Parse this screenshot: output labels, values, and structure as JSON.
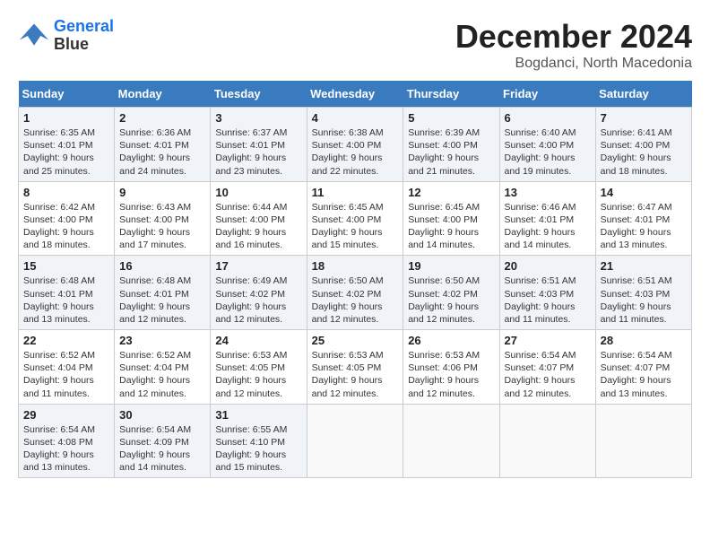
{
  "header": {
    "logo_line1": "General",
    "logo_line2": "Blue",
    "month_title": "December 2024",
    "location": "Bogdanci, North Macedonia"
  },
  "weekdays": [
    "Sunday",
    "Monday",
    "Tuesday",
    "Wednesday",
    "Thursday",
    "Friday",
    "Saturday"
  ],
  "weeks": [
    [
      {
        "day": "1",
        "sunrise": "6:35 AM",
        "sunset": "4:01 PM",
        "daylight": "9 hours and 25 minutes."
      },
      {
        "day": "2",
        "sunrise": "6:36 AM",
        "sunset": "4:01 PM",
        "daylight": "9 hours and 24 minutes."
      },
      {
        "day": "3",
        "sunrise": "6:37 AM",
        "sunset": "4:01 PM",
        "daylight": "9 hours and 23 minutes."
      },
      {
        "day": "4",
        "sunrise": "6:38 AM",
        "sunset": "4:00 PM",
        "daylight": "9 hours and 22 minutes."
      },
      {
        "day": "5",
        "sunrise": "6:39 AM",
        "sunset": "4:00 PM",
        "daylight": "9 hours and 21 minutes."
      },
      {
        "day": "6",
        "sunrise": "6:40 AM",
        "sunset": "4:00 PM",
        "daylight": "9 hours and 19 minutes."
      },
      {
        "day": "7",
        "sunrise": "6:41 AM",
        "sunset": "4:00 PM",
        "daylight": "9 hours and 18 minutes."
      }
    ],
    [
      {
        "day": "8",
        "sunrise": "6:42 AM",
        "sunset": "4:00 PM",
        "daylight": "9 hours and 18 minutes."
      },
      {
        "day": "9",
        "sunrise": "6:43 AM",
        "sunset": "4:00 PM",
        "daylight": "9 hours and 17 minutes."
      },
      {
        "day": "10",
        "sunrise": "6:44 AM",
        "sunset": "4:00 PM",
        "daylight": "9 hours and 16 minutes."
      },
      {
        "day": "11",
        "sunrise": "6:45 AM",
        "sunset": "4:00 PM",
        "daylight": "9 hours and 15 minutes."
      },
      {
        "day": "12",
        "sunrise": "6:45 AM",
        "sunset": "4:00 PM",
        "daylight": "9 hours and 14 minutes."
      },
      {
        "day": "13",
        "sunrise": "6:46 AM",
        "sunset": "4:01 PM",
        "daylight": "9 hours and 14 minutes."
      },
      {
        "day": "14",
        "sunrise": "6:47 AM",
        "sunset": "4:01 PM",
        "daylight": "9 hours and 13 minutes."
      }
    ],
    [
      {
        "day": "15",
        "sunrise": "6:48 AM",
        "sunset": "4:01 PM",
        "daylight": "9 hours and 13 minutes."
      },
      {
        "day": "16",
        "sunrise": "6:48 AM",
        "sunset": "4:01 PM",
        "daylight": "9 hours and 12 minutes."
      },
      {
        "day": "17",
        "sunrise": "6:49 AM",
        "sunset": "4:02 PM",
        "daylight": "9 hours and 12 minutes."
      },
      {
        "day": "18",
        "sunrise": "6:50 AM",
        "sunset": "4:02 PM",
        "daylight": "9 hours and 12 minutes."
      },
      {
        "day": "19",
        "sunrise": "6:50 AM",
        "sunset": "4:02 PM",
        "daylight": "9 hours and 12 minutes."
      },
      {
        "day": "20",
        "sunrise": "6:51 AM",
        "sunset": "4:03 PM",
        "daylight": "9 hours and 11 minutes."
      },
      {
        "day": "21",
        "sunrise": "6:51 AM",
        "sunset": "4:03 PM",
        "daylight": "9 hours and 11 minutes."
      }
    ],
    [
      {
        "day": "22",
        "sunrise": "6:52 AM",
        "sunset": "4:04 PM",
        "daylight": "9 hours and 11 minutes."
      },
      {
        "day": "23",
        "sunrise": "6:52 AM",
        "sunset": "4:04 PM",
        "daylight": "9 hours and 12 minutes."
      },
      {
        "day": "24",
        "sunrise": "6:53 AM",
        "sunset": "4:05 PM",
        "daylight": "9 hours and 12 minutes."
      },
      {
        "day": "25",
        "sunrise": "6:53 AM",
        "sunset": "4:05 PM",
        "daylight": "9 hours and 12 minutes."
      },
      {
        "day": "26",
        "sunrise": "6:53 AM",
        "sunset": "4:06 PM",
        "daylight": "9 hours and 12 minutes."
      },
      {
        "day": "27",
        "sunrise": "6:54 AM",
        "sunset": "4:07 PM",
        "daylight": "9 hours and 12 minutes."
      },
      {
        "day": "28",
        "sunrise": "6:54 AM",
        "sunset": "4:07 PM",
        "daylight": "9 hours and 13 minutes."
      }
    ],
    [
      {
        "day": "29",
        "sunrise": "6:54 AM",
        "sunset": "4:08 PM",
        "daylight": "9 hours and 13 minutes."
      },
      {
        "day": "30",
        "sunrise": "6:54 AM",
        "sunset": "4:09 PM",
        "daylight": "9 hours and 14 minutes."
      },
      {
        "day": "31",
        "sunrise": "6:55 AM",
        "sunset": "4:10 PM",
        "daylight": "9 hours and 15 minutes."
      },
      null,
      null,
      null,
      null
    ]
  ]
}
